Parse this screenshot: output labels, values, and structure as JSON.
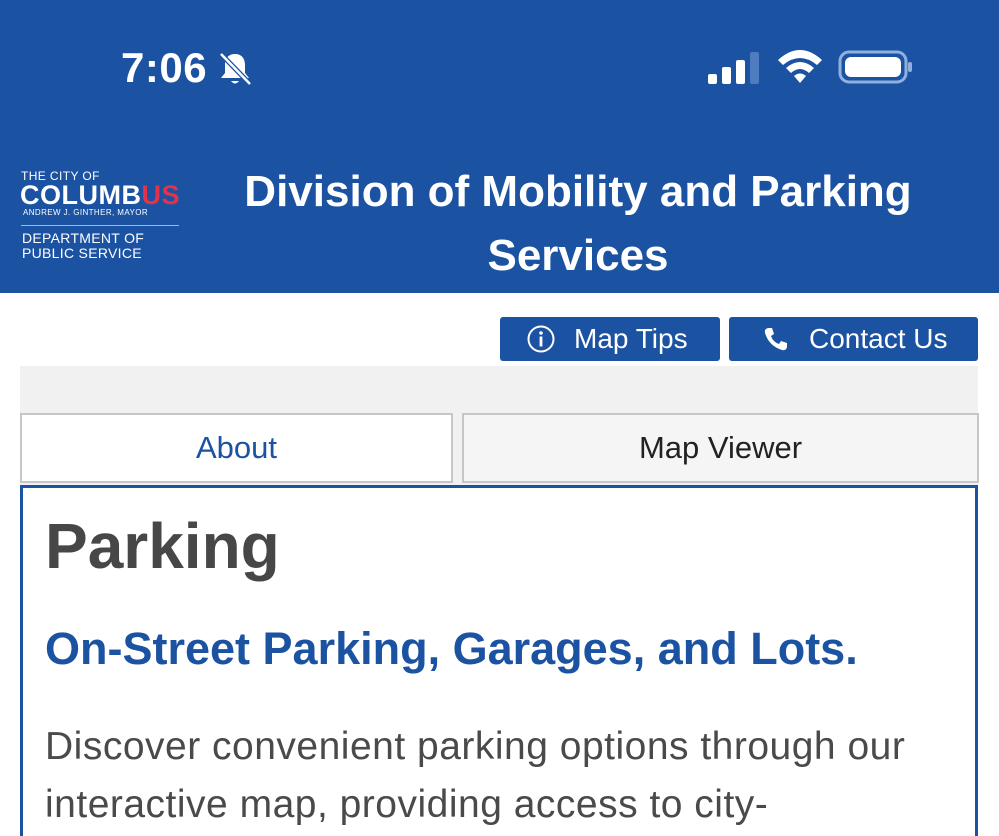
{
  "status_bar": {
    "time": "7:06",
    "icons": [
      "bell-slash-icon",
      "cellular-signal-icon",
      "wifi-icon",
      "battery-icon"
    ]
  },
  "header": {
    "logo": {
      "line1": "THE CITY OF",
      "name_main": "COLUMB",
      "name_accent": "US",
      "mayor": "ANDREW J. GINTHER, MAYOR",
      "dept_line1": "DEPARTMENT OF",
      "dept_line2": "PUBLIC SERVICE"
    },
    "title": "Division of Mobility and Parking Services"
  },
  "toolbar": {
    "map_tips_label": "Map Tips",
    "contact_us_label": "Contact Us"
  },
  "tabs": [
    {
      "label": "About",
      "active": true
    },
    {
      "label": "Map Viewer",
      "active": false
    }
  ],
  "content": {
    "heading": "Parking",
    "subheading": "On-Street Parking, Garages, and Lots.",
    "body": "Discover convenient parking options through our interactive map, providing access to city-"
  },
  "colors": {
    "brand_blue": "#1b52a2",
    "accent_red": "#e2334b",
    "heading_gray": "#474747",
    "tab_border": "#c6c6c6"
  }
}
